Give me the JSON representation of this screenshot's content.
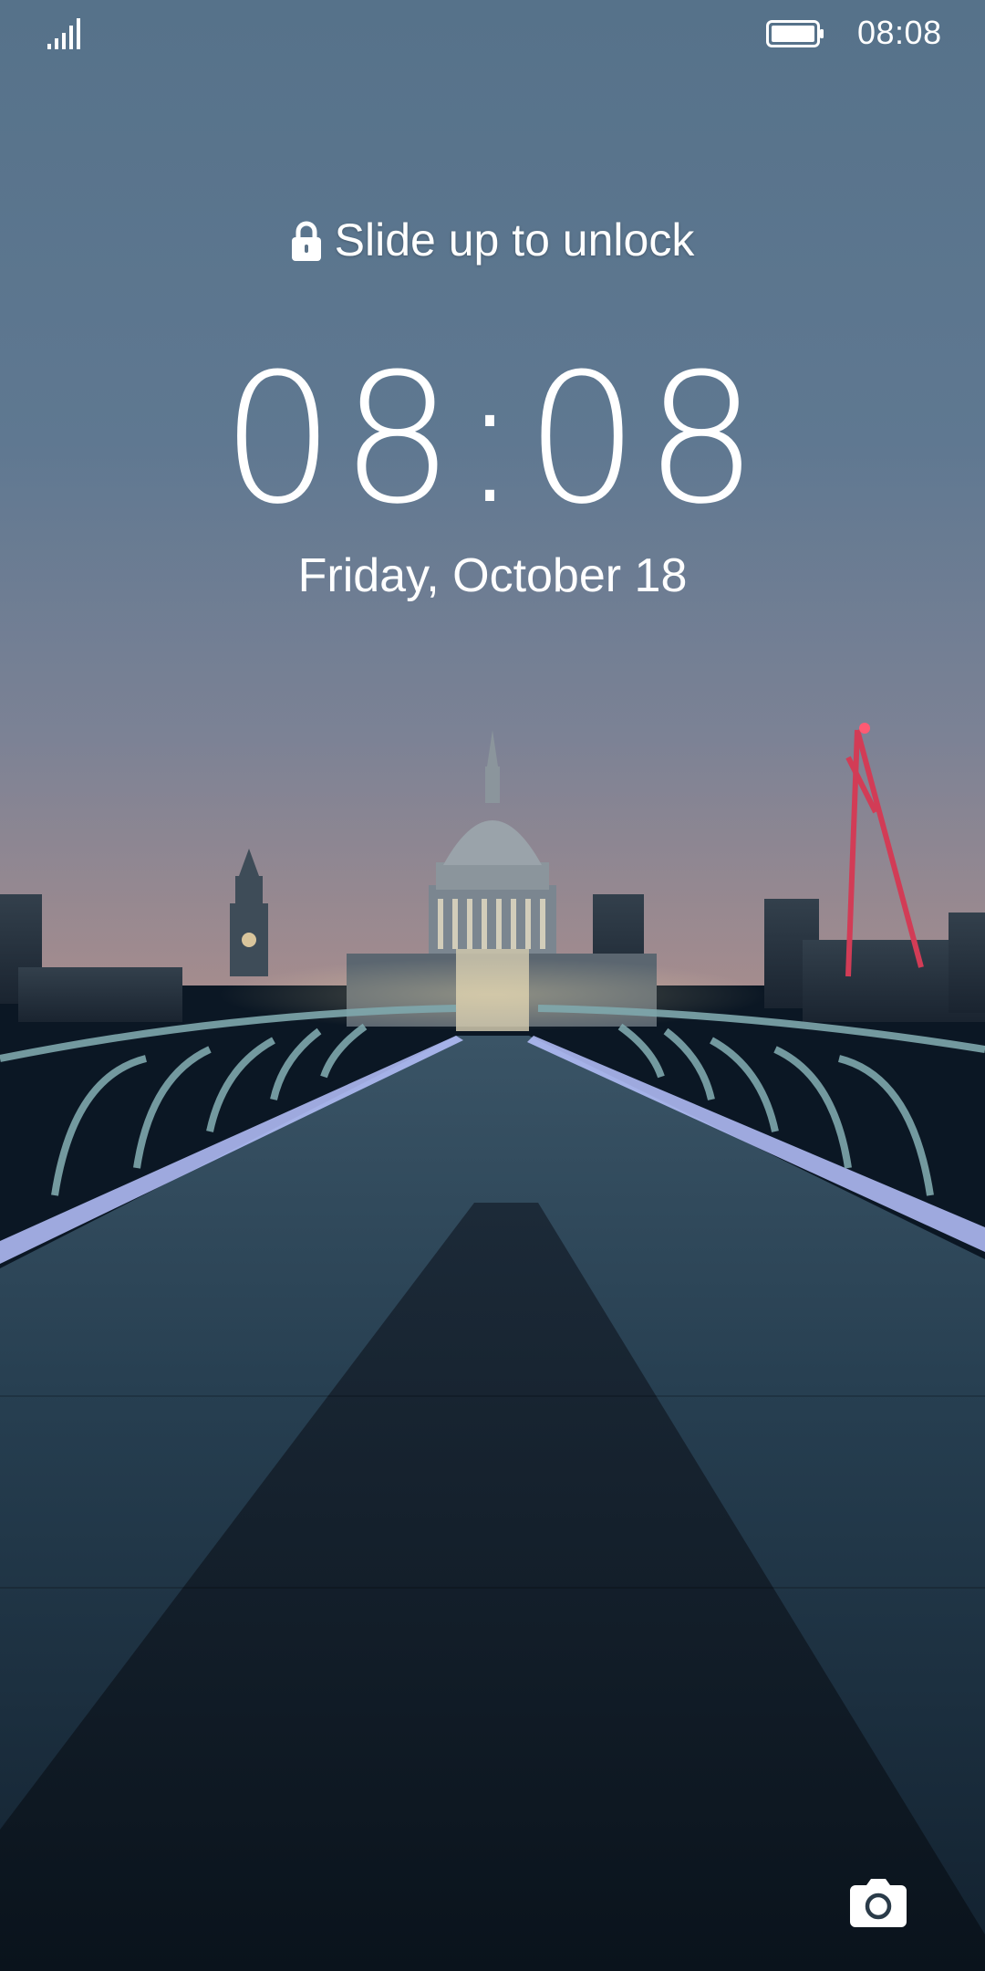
{
  "status_bar": {
    "time": "08:08",
    "signal_icon": "signal-strength-icon",
    "battery_icon": "battery-icon",
    "battery_level": 1.0
  },
  "lock_screen": {
    "unlock_hint": "Slide up to unlock",
    "lock_icon": "lock-icon",
    "clock": "08:08",
    "date": "Friday, October 18",
    "camera_shortcut_icon": "camera-icon"
  },
  "wallpaper": {
    "sky_top": "#56728a",
    "sky_horizon": "#9a8a90",
    "deck_color": "#1f3344",
    "accent_light": "#b9c3ff"
  }
}
